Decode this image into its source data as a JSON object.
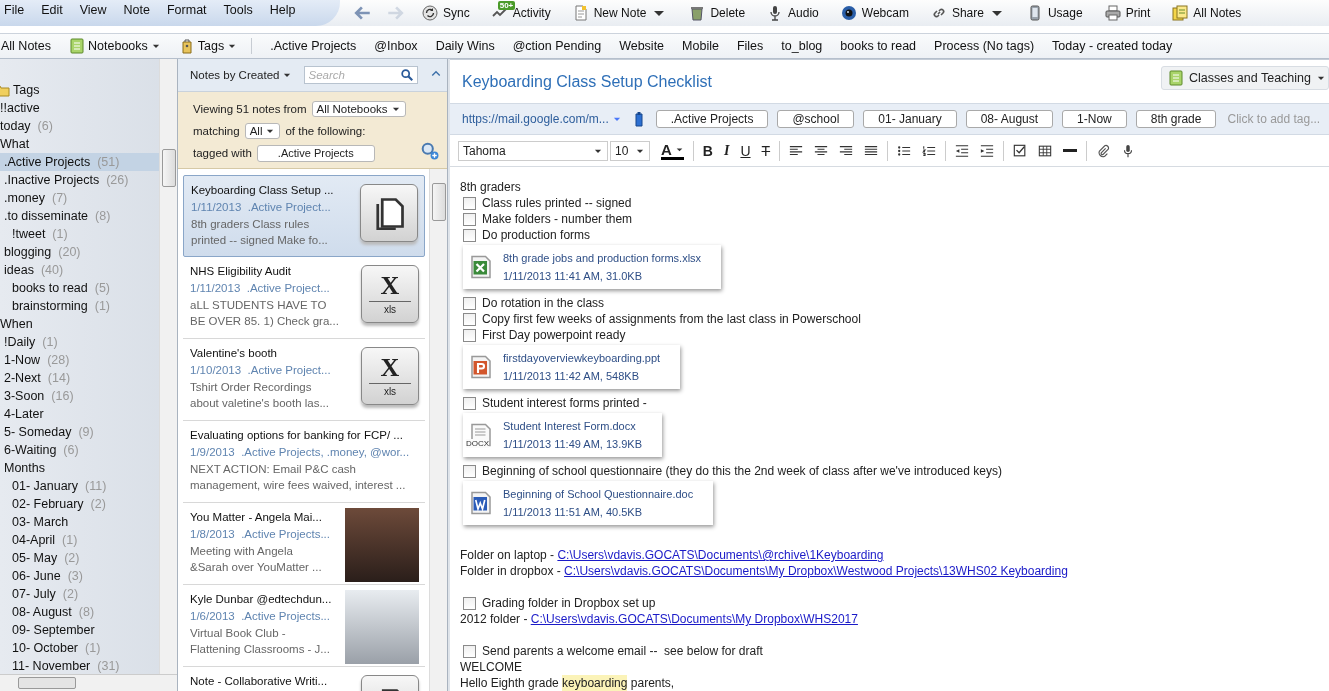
{
  "menu": [
    "File",
    "Edit",
    "View",
    "Note",
    "Format",
    "Tools",
    "Help"
  ],
  "toolbar": [
    {
      "kind": "back",
      "disabled": false
    },
    {
      "kind": "forward",
      "disabled": true
    },
    {
      "kind": "sync",
      "label": "Sync"
    },
    {
      "kind": "activity",
      "label": "Activity",
      "badge": "50+"
    },
    {
      "kind": "new-note",
      "label": "New Note",
      "caret": true
    },
    {
      "kind": "delete",
      "label": "Delete"
    },
    {
      "kind": "audio",
      "label": "Audio"
    },
    {
      "kind": "webcam",
      "label": "Webcam"
    },
    {
      "kind": "share",
      "label": "Share",
      "caret": true
    },
    {
      "kind": "usage",
      "label": "Usage"
    },
    {
      "kind": "print",
      "label": "Print"
    },
    {
      "kind": "all-notes",
      "label": "All Notes"
    }
  ],
  "shortcuts": [
    {
      "kind": "plain",
      "label": "All Notes"
    },
    {
      "kind": "notebooks",
      "label": "Notebooks"
    },
    {
      "kind": "tags",
      "label": "Tags"
    },
    {
      "kind": "plain",
      "label": ".Active Projects"
    },
    {
      "kind": "plain",
      "label": "@Inbox"
    },
    {
      "kind": "plain",
      "label": "Daily Wins"
    },
    {
      "kind": "plain",
      "label": "@ction Pending"
    },
    {
      "kind": "plain",
      "label": "Website"
    },
    {
      "kind": "plain",
      "label": "Mobile"
    },
    {
      "kind": "plain",
      "label": "Files"
    },
    {
      "kind": "plain",
      "label": "to_blog"
    },
    {
      "kind": "plain",
      "label": "books to read"
    },
    {
      "kind": "plain",
      "label": "Process (No tags)"
    },
    {
      "kind": "plain",
      "label": "Today - created today"
    }
  ],
  "sidebar": {
    "header": "Tags",
    "items": [
      {
        "label": "!!active",
        "selected": false
      },
      {
        "label": "today",
        "count": "(6)",
        "selected": false
      },
      {
        "label": "What",
        "selected": false,
        "children": [
          {
            "label": ".Active Projects",
            "count": "(51)",
            "selected": true
          },
          {
            "label": ".Inactive Projects",
            "count": "(26)",
            "selected": false
          },
          {
            "label": ".money",
            "count": "(7)",
            "selected": false
          },
          {
            "label": ".to disseminate",
            "count": "(8)",
            "selected": false,
            "children": [
              {
                "label": "!tweet",
                "count": "(1)",
                "selected": false
              }
            ]
          },
          {
            "label": "blogging",
            "count": "(20)",
            "selected": false
          },
          {
            "label": "ideas",
            "count": "(40)",
            "selected": false,
            "children": [
              {
                "label": "books to read",
                "count": "(5)",
                "selected": false
              },
              {
                "label": "brainstorming",
                "count": "(1)",
                "selected": false
              }
            ]
          }
        ]
      },
      {
        "label": "When",
        "selected": false,
        "children": [
          {
            "label": "!Daily",
            "count": "(1)",
            "selected": false
          },
          {
            "label": "1-Now",
            "count": "(28)",
            "selected": false
          },
          {
            "label": "2-Next",
            "count": "(14)",
            "selected": false
          },
          {
            "label": "3-Soon",
            "count": "(16)",
            "selected": false
          },
          {
            "label": "4-Later",
            "selected": false
          },
          {
            "label": "5- Someday",
            "count": "(9)",
            "selected": false
          },
          {
            "label": "6-Waiting",
            "count": "(6)",
            "selected": false
          },
          {
            "label": "Months",
            "selected": false,
            "children": [
              {
                "label": "01- January",
                "count": "(11)",
                "selected": false
              },
              {
                "label": "02- February",
                "count": "(2)",
                "selected": false
              },
              {
                "label": "03- March",
                "selected": false
              },
              {
                "label": "04-April",
                "count": "(1)",
                "selected": false
              },
              {
                "label": "05- May",
                "count": "(2)",
                "selected": false
              },
              {
                "label": "06- June",
                "count": "(3)",
                "selected": false
              },
              {
                "label": "07- July",
                "count": "(2)",
                "selected": false
              },
              {
                "label": "08- August",
                "count": "(8)",
                "selected": false
              },
              {
                "label": "09- September",
                "selected": false
              },
              {
                "label": "10- October",
                "count": "(1)",
                "selected": false
              },
              {
                "label": "11- November",
                "count": "(31)",
                "selected": false
              }
            ]
          }
        ]
      }
    ]
  },
  "note_list": {
    "sort": "Notes by Created",
    "search": {
      "placeholder": "Search"
    },
    "filter": {
      "viewing": "Viewing 51 notes from",
      "notebook": "All Notebooks",
      "matching": "matching",
      "match_mode": "All",
      "following": "of the following:",
      "tagged": "tagged with",
      "tag": ".Active Projects"
    },
    "notes": [
      {
        "title": "Keyboarding Class Setup ...",
        "date": "1/11/2013",
        "tags": ".Active Project...",
        "snippet": [
          "8th graders Class rules",
          "printed -- signed Make fo..."
        ],
        "thumb": {
          "kind": "document"
        },
        "selected": true
      },
      {
        "title": "NHS Eligibility Audit",
        "date": "1/11/2013",
        "tags": ".Active Project...",
        "snippet": [
          "aLL STUDENTS HAVE TO",
          "BE OVER 85. 1) Check gra..."
        ],
        "thumb": {
          "kind": "xls",
          "letter": "X",
          "caption": "xls"
        },
        "selected": false
      },
      {
        "title": "Valentine's booth",
        "date": "1/10/2013",
        "tags": ".Active Project...",
        "snippet": [
          "Tshirt Order Recordings",
          "about valetine's booth las..."
        ],
        "thumb": {
          "kind": "xls",
          "letter": "X",
          "caption": "xls"
        },
        "selected": false
      },
      {
        "title": "Evaluating options for banking for FCP/ ...",
        "date": "1/9/2013",
        "tags": ".Active Projects, .money, @wor...",
        "snippet": [
          "NEXT ACTION: Email P&C cash",
          "management, wire fees waived, interest ..."
        ],
        "selected": false
      },
      {
        "title": "You Matter - Angela Mai...",
        "date": "1/8/2013",
        "tags": ".Active Projects...",
        "snippet": [
          "Meeting with Angela",
          "&Sarah over YouMatter ..."
        ],
        "thumb": {
          "kind": "photo"
        },
        "selected": false
      },
      {
        "title": "Kyle Dunbar @edtechdun...",
        "date": "1/6/2013",
        "tags": ".Active Projects...",
        "snippet": [
          "Virtual Book Club -",
          "Flattening Classrooms - J..."
        ],
        "thumb": {
          "kind": "screenshot"
        },
        "selected": false
      },
      {
        "title": "Note - Collaborative Writi...",
        "thumb": {
          "kind": "document"
        },
        "selected": false
      }
    ]
  },
  "editor": {
    "title": "Keyboarding Class Setup Checklist",
    "notebook": "Classes and Teaching",
    "url": "https://mail.google.com/m...",
    "tags": [
      ".Active Projects",
      "@school",
      "01- January",
      "08- August",
      "1-Now",
      "8th grade"
    ],
    "tag_placeholder": "Click to add tag...",
    "font": "Tahoma",
    "size": "10",
    "tools": [
      [
        {
          "kind": "color",
          "label": "A"
        }
      ],
      [
        {
          "kind": "bold",
          "label": "B"
        },
        {
          "kind": "italic",
          "label": "I"
        },
        {
          "kind": "underline",
          "label": "U"
        },
        {
          "kind": "strike",
          "label": "T"
        }
      ],
      [
        {
          "kind": "align-left"
        },
        {
          "kind": "align-center"
        },
        {
          "kind": "align-right"
        },
        {
          "kind": "justify"
        }
      ],
      [
        {
          "kind": "bullets"
        },
        {
          "kind": "numbers"
        }
      ],
      [
        {
          "kind": "outdent"
        },
        {
          "kind": "indent"
        }
      ],
      [
        {
          "kind": "checkbox"
        },
        {
          "kind": "table"
        },
        {
          "kind": "rule"
        }
      ],
      [
        {
          "kind": "attach"
        },
        {
          "kind": "mic"
        }
      ]
    ],
    "body": [
      {
        "kind": "text",
        "text": "8th graders"
      },
      {
        "kind": "check",
        "text": "Class rules printed -- signed",
        "checked": false
      },
      {
        "kind": "check",
        "text": "Make folders - number them",
        "checked": false
      },
      {
        "kind": "check",
        "text": "Do production forms",
        "checked": false
      },
      {
        "kind": "attachment",
        "file": {
          "kind": "excel",
          "name": "8th grade jobs and production forms.xlsx",
          "meta": "1/11/2013 11:41 AM, 31.0KB"
        }
      },
      {
        "kind": "check",
        "text": "Do rotation in the class",
        "checked": false
      },
      {
        "kind": "check",
        "text": "Copy first few weeks of assignments from the last class in Powerschool",
        "checked": false
      },
      {
        "kind": "check",
        "text": "First Day powerpoint ready",
        "checked": false
      },
      {
        "kind": "attachment",
        "file": {
          "kind": "powerpoint",
          "name": "firstdayoverviewkeyboarding.ppt",
          "meta": "1/11/2013 11:42 AM, 548KB"
        }
      },
      {
        "kind": "check",
        "text": "Student interest forms printed -",
        "checked": false
      },
      {
        "kind": "attachment",
        "file": {
          "kind": "docx",
          "name": "Student Interest Form.docx",
          "meta": "1/11/2013 11:49 AM, 13.9KB",
          "label": "DOCX"
        }
      },
      {
        "kind": "check",
        "text": "Beginning of school questionnaire (they do this the 2nd week of class after we've introduced keys)",
        "checked": false
      },
      {
        "kind": "attachment",
        "file": {
          "kind": "word",
          "name": "Beginning of School Questionnaire.doc",
          "meta": "1/11/2013 11:51 AM, 40.5KB"
        }
      },
      {
        "kind": "spacer"
      },
      {
        "kind": "link",
        "text": "Folder on laptop - ",
        "link": "C:\\Users\\vdavis.GOCATS\\Documents\\@rchive\\1Keyboarding"
      },
      {
        "kind": "link",
        "text": "Folder in dropbox - ",
        "link": "C:\\Users\\vdavis.GOCATS\\Documents\\My Dropbox\\Westwood Projects\\13WHS02 Keyboarding"
      },
      {
        "kind": "spacer"
      },
      {
        "kind": "check",
        "text": "Grading folder in Dropbox set up",
        "checked": false
      },
      {
        "kind": "link",
        "text": "2012 folder - ",
        "link": "C:\\Users\\vdavis.GOCATS\\Documents\\My Dropbox\\WHS2017"
      },
      {
        "kind": "spacer"
      },
      {
        "kind": "check",
        "text": "Send parents a welcome email --  see below for draft",
        "checked": false
      },
      {
        "kind": "text",
        "text": "WELCOME"
      },
      {
        "kind": "highlighted",
        "before": "Hello Eighth grade ",
        "mark": "keyboarding",
        "after": " parents,"
      }
    ]
  }
}
